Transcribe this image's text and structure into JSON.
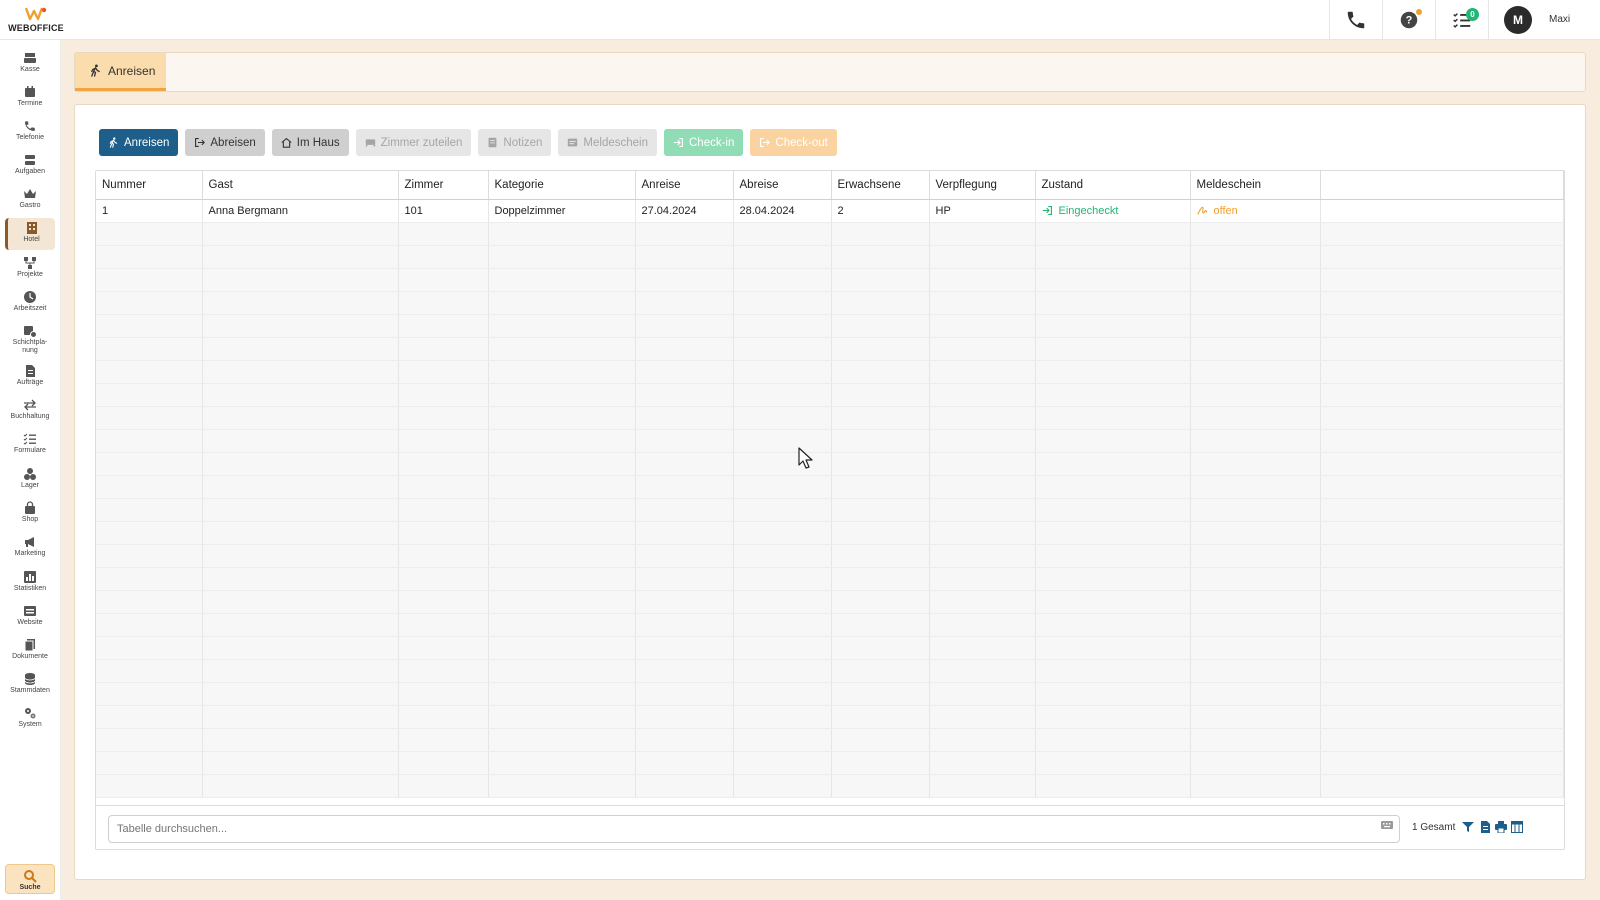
{
  "app": {
    "logo_text": "WEBOFFICE",
    "user_initial": "M",
    "user_name": "Maxi",
    "task_badge": "0"
  },
  "sidebar": {
    "items": [
      {
        "label": "Kasse",
        "icon": "register-icon"
      },
      {
        "label": "Termine",
        "icon": "calendar-icon"
      },
      {
        "label": "Telefonie",
        "icon": "phone-icon"
      },
      {
        "label": "Aufgaben",
        "icon": "tasks-icon"
      },
      {
        "label": "Gastro",
        "icon": "crown-icon"
      },
      {
        "label": "Hotel",
        "icon": "hotel-icon"
      },
      {
        "label": "Projekte",
        "icon": "projects-icon"
      },
      {
        "label": "Arbeitszeit",
        "icon": "clock-icon"
      },
      {
        "label": "Schichtpla-nung",
        "icon": "shift-icon"
      },
      {
        "label": "Aufträge",
        "icon": "orders-icon"
      },
      {
        "label": "Buchhaltung",
        "icon": "exchange-icon"
      },
      {
        "label": "Formulare",
        "icon": "list-icon"
      },
      {
        "label": "Lager",
        "icon": "boxes-icon"
      },
      {
        "label": "Shop",
        "icon": "bag-icon"
      },
      {
        "label": "Marketing",
        "icon": "megaphone-icon"
      },
      {
        "label": "Statistiken",
        "icon": "chart-icon"
      },
      {
        "label": "Website",
        "icon": "website-icon"
      },
      {
        "label": "Dokumente",
        "icon": "documents-icon"
      },
      {
        "label": "Stammdaten",
        "icon": "database-icon"
      },
      {
        "label": "System",
        "icon": "gears-icon"
      }
    ],
    "search_label": "Suche"
  },
  "tabs": {
    "active_label": "Anreisen"
  },
  "toolbar": {
    "anreisen": "Anreisen",
    "abreisen": "Abreisen",
    "im_haus": "Im Haus",
    "zimmer_zuteilen": "Zimmer zuteilen",
    "notizen": "Notizen",
    "meldeschein": "Meldeschein",
    "check_in": "Check-in",
    "check_out": "Check-out"
  },
  "table": {
    "columns": [
      "Nummer",
      "Gast",
      "Zimmer",
      "Kategorie",
      "Anreise",
      "Abreise",
      "Erwachsene",
      "Verpflegung",
      "Zustand",
      "Meldeschein",
      ""
    ],
    "rows": [
      [
        "1",
        "Anna Bergmann",
        "101",
        "Doppelzimmer",
        "27.04.2024",
        "28.04.2024",
        "2",
        "HP",
        "Eingecheckt",
        "offen",
        ""
      ]
    ]
  },
  "footer": {
    "search_placeholder": "Tabelle durchsuchen...",
    "count": "1 Gesamt"
  },
  "colors": {
    "primary": "#1d5e8a",
    "accent": "#f0a540",
    "success": "#22b573",
    "warning": "#f0a030"
  }
}
